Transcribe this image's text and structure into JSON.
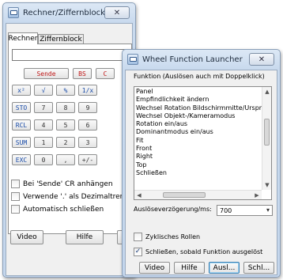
{
  "calc_window": {
    "title": "Rechner/Ziffernblock",
    "tabs": [
      "Rechner",
      "Ziffernblock"
    ],
    "input_value": "",
    "keys": {
      "send": "Sende",
      "bs": "BS",
      "c": "C",
      "x2": "x²",
      "sqrt": "√",
      "pct": "%",
      "inv": "1/x",
      "sto": "STO",
      "rcl": "RCL",
      "sum": "SUM",
      "exc": "EXC",
      "d7": "7",
      "d8": "8",
      "d9": "9",
      "d4": "4",
      "d5": "5",
      "d6": "6",
      "d1": "1",
      "d2": "2",
      "d3": "3",
      "d0": "0",
      "comma": ",",
      "neg": "+/-"
    },
    "options": [
      {
        "label": "Bei 'Sende' CR anhängen",
        "checked": false
      },
      {
        "label": "Verwende '.' als Dezimaltrennzeichen",
        "checked": false
      },
      {
        "label": "Automatisch schließen",
        "checked": false
      }
    ],
    "buttons": {
      "video": "Video",
      "help": "Hilfe"
    }
  },
  "launcher_window": {
    "title": "Wheel Function Launcher",
    "list_label": "Funktion (Auslösen auch mit Doppelklick)",
    "functions": [
      "Panel",
      "Empfindlichkeit ändern",
      "Wechsel Rotation Bildschirmmitte/Ursprung",
      "Wechsel Objekt-/Kameramodus",
      "Rotation ein/aus",
      "Dominantmodus ein/aus",
      "Fit",
      "Front",
      "Right",
      "Top",
      "Schließen"
    ],
    "delay_label": "Auslöseverzögerung/ms:",
    "delay_value": "700",
    "cyclic_label": "Zyklisches Rollen",
    "cyclic_checked": false,
    "close_after_label": "Schließen, sobald Funktion ausgelöst",
    "close_after_checked": true,
    "buttons": {
      "video": "Video",
      "help": "Hilfe",
      "trigger": "Ausl...",
      "close": "Schl..."
    }
  },
  "icons": {
    "close": "close-icon",
    "app": "app-icon"
  }
}
